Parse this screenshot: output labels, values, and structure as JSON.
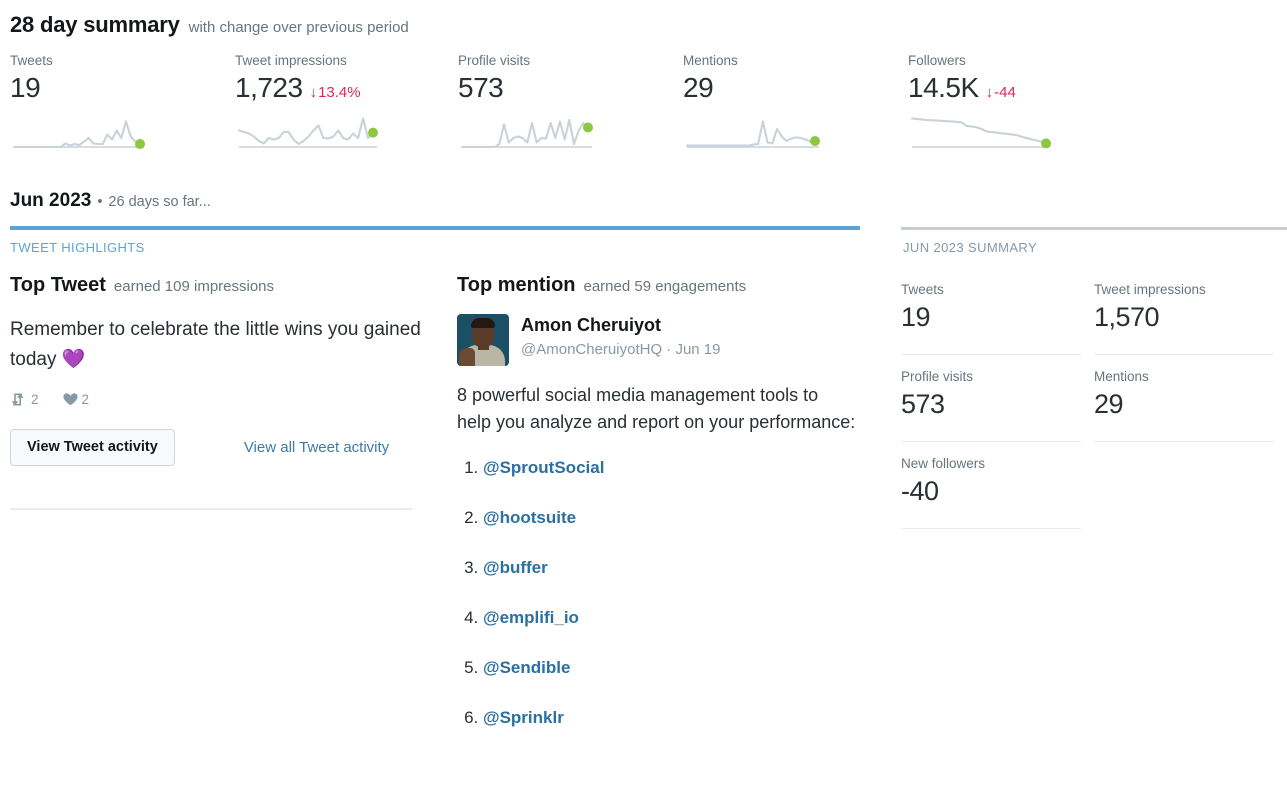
{
  "summary": {
    "title": "28 day summary",
    "subtitle": "with change over previous period",
    "metrics": [
      {
        "label": "Tweets",
        "value": "19",
        "delta": "",
        "arrow": ""
      },
      {
        "label": "Tweet impressions",
        "value": "1,723",
        "delta": "13.4%",
        "arrow": "↓"
      },
      {
        "label": "Profile visits",
        "value": "573",
        "delta": "",
        "arrow": ""
      },
      {
        "label": "Mentions",
        "value": "29",
        "delta": "",
        "arrow": ""
      },
      {
        "label": "Followers",
        "value": "14.5K",
        "delta": "-44",
        "arrow": "↓"
      }
    ]
  },
  "month": {
    "title": "Jun 2023",
    "separator": "•",
    "subtitle": "26 days so far...",
    "highlights_label": "TWEET HIGHLIGHTS",
    "summary_label": "JUN 2023 SUMMARY"
  },
  "top_tweet": {
    "title": "Top Tweet",
    "subtitle": "earned 109 impressions",
    "text": "Remember to celebrate the little wins you gained today",
    "emoji": "💜",
    "retweets": "2",
    "likes": "2",
    "button_label": "View Tweet activity",
    "link_label": "View all Tweet activity"
  },
  "top_mention": {
    "title": "Top mention",
    "subtitle": "earned 59 engagements",
    "author_name": "Amon Cheruiyot",
    "author_handle": "@AmonCheruiyotHQ",
    "handle_separator": "·",
    "date": "Jun 19",
    "text": "8 powerful social media management tools to help you analyze and report on your performance:",
    "tools": [
      "@SproutSocial",
      "@hootsuite",
      "@buffer",
      "@emplifi_io",
      "@Sendible",
      "@Sprinklr"
    ]
  },
  "month_summary": {
    "cells": [
      {
        "label": "Tweets",
        "value": "19"
      },
      {
        "label": "Tweet impressions",
        "value": "1,570"
      },
      {
        "label": "Profile visits",
        "value": "573"
      },
      {
        "label": "Mentions",
        "value": "29"
      },
      {
        "label": "New followers",
        "value": "-40"
      },
      {
        "label": "",
        "value": ""
      }
    ]
  },
  "colors": {
    "accent_blue": "#5ba4d8",
    "link_blue": "#2b6fa3",
    "negative_red": "#e0245e",
    "spark_line": "#c8d2d8",
    "spark_dot": "#8dc63f",
    "muted_text": "#66757f"
  },
  "chart_data": [
    {
      "type": "line",
      "title": "Tweets sparkline",
      "points": [
        0,
        0,
        0,
        0,
        0,
        0,
        0,
        0,
        0,
        0,
        0,
        0.12,
        0.05,
        0.1,
        0.06,
        0.18,
        0.3,
        0.12,
        0.1,
        0.1,
        0.42,
        0.25,
        0.55,
        0.3,
        0.85,
        0.35,
        0.18,
        0.1
      ],
      "end_marker": true
    },
    {
      "type": "line",
      "title": "Tweet impressions sparkline",
      "points": [
        0.55,
        0.5,
        0.45,
        0.35,
        0.2,
        0.12,
        0.3,
        0.25,
        0.3,
        0.5,
        0.5,
        0.25,
        0.1,
        0.2,
        0.35,
        0.55,
        0.72,
        0.3,
        0.28,
        0.35,
        0.55,
        0.3,
        0.25,
        0.45,
        0.3,
        0.95,
        0.3,
        0.48
      ],
      "end_marker": true
    },
    {
      "type": "line",
      "title": "Profile visits sparkline",
      "points": [
        0,
        0,
        0,
        0,
        0,
        0,
        0,
        0,
        0.1,
        0.75,
        0.15,
        0.3,
        0.35,
        0.3,
        0.15,
        0.8,
        0.15,
        0.3,
        0.28,
        0.8,
        0.3,
        0.85,
        0.25,
        0.9,
        0.1,
        0.55,
        0.8,
        0.65
      ],
      "end_marker": true
    },
    {
      "type": "line",
      "title": "Mentions sparkline",
      "points": [
        0.05,
        0.05,
        0.05,
        0.05,
        0.05,
        0.05,
        0.05,
        0.05,
        0.05,
        0.05,
        0.05,
        0.05,
        0.05,
        0.05,
        0.08,
        0.1,
        0.85,
        0.15,
        0.12,
        0.6,
        0.35,
        0.2,
        0.28,
        0.32,
        0.3,
        0.25,
        0.18,
        0.2
      ],
      "end_marker": true
    },
    {
      "type": "line",
      "title": "Followers sparkline",
      "points": [
        0.95,
        0.93,
        0.92,
        0.9,
        0.89,
        0.88,
        0.87,
        0.86,
        0.85,
        0.84,
        0.82,
        0.7,
        0.68,
        0.66,
        0.6,
        0.52,
        0.5,
        0.48,
        0.46,
        0.44,
        0.42,
        0.4,
        0.35,
        0.3,
        0.26,
        0.22,
        0.18,
        0.12
      ],
      "end_marker": true
    }
  ]
}
